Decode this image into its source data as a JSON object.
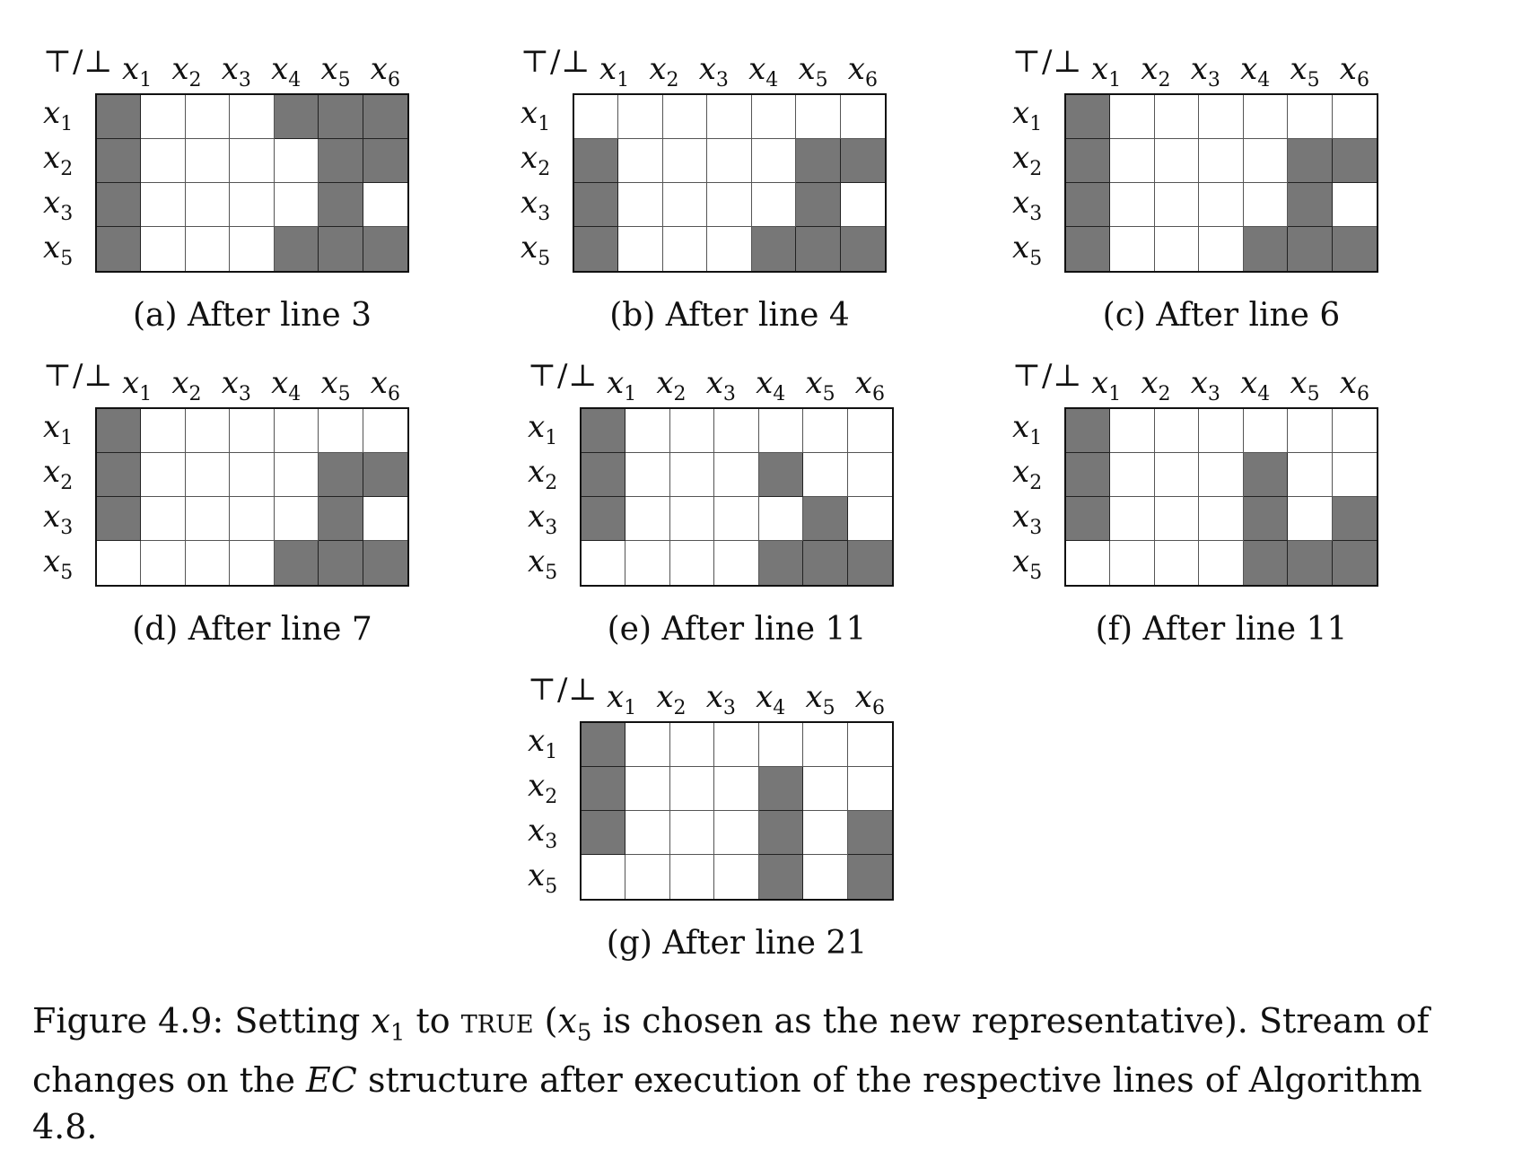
{
  "header": {
    "top_bottom": "⊤/⊥",
    "vars": [
      "x",
      "x",
      "x",
      "x",
      "x",
      "x"
    ],
    "var_subs": [
      "1",
      "2",
      "3",
      "4",
      "5",
      "6"
    ]
  },
  "rows": {
    "labels": [
      "x",
      "x",
      "x",
      "x"
    ],
    "subs": [
      "1",
      "2",
      "3",
      "5"
    ]
  },
  "panels": [
    {
      "caption": "(a) After line 3",
      "grid": [
        [
          1,
          0,
          0,
          0,
          1,
          1,
          1
        ],
        [
          1,
          0,
          0,
          0,
          0,
          1,
          1
        ],
        [
          1,
          0,
          0,
          0,
          0,
          1,
          0
        ],
        [
          1,
          0,
          0,
          0,
          1,
          1,
          1
        ]
      ]
    },
    {
      "caption": "(b) After line 4",
      "grid": [
        [
          0,
          0,
          0,
          0,
          0,
          0,
          0
        ],
        [
          1,
          0,
          0,
          0,
          0,
          1,
          1
        ],
        [
          1,
          0,
          0,
          0,
          0,
          1,
          0
        ],
        [
          1,
          0,
          0,
          0,
          1,
          1,
          1
        ]
      ]
    },
    {
      "caption": "(c) After line 6",
      "grid": [
        [
          1,
          0,
          0,
          0,
          0,
          0,
          0
        ],
        [
          1,
          0,
          0,
          0,
          0,
          1,
          1
        ],
        [
          1,
          0,
          0,
          0,
          0,
          1,
          0
        ],
        [
          1,
          0,
          0,
          0,
          1,
          1,
          1
        ]
      ]
    },
    {
      "caption": "(d) After line 7",
      "grid": [
        [
          1,
          0,
          0,
          0,
          0,
          0,
          0
        ],
        [
          1,
          0,
          0,
          0,
          0,
          1,
          1
        ],
        [
          1,
          0,
          0,
          0,
          0,
          1,
          0
        ],
        [
          0,
          0,
          0,
          0,
          1,
          1,
          1
        ]
      ]
    },
    {
      "caption": "(e) After line 11",
      "grid": [
        [
          1,
          0,
          0,
          0,
          0,
          0,
          0
        ],
        [
          1,
          0,
          0,
          0,
          1,
          0,
          0
        ],
        [
          1,
          0,
          0,
          0,
          0,
          1,
          0
        ],
        [
          0,
          0,
          0,
          0,
          1,
          1,
          1
        ]
      ]
    },
    {
      "caption": "(f) After line 11",
      "grid": [
        [
          1,
          0,
          0,
          0,
          0,
          0,
          0
        ],
        [
          1,
          0,
          0,
          0,
          1,
          0,
          0
        ],
        [
          1,
          0,
          0,
          0,
          1,
          0,
          1
        ],
        [
          0,
          0,
          0,
          0,
          1,
          1,
          1
        ]
      ]
    },
    {
      "caption": "(g) After line 21",
      "grid": [
        [
          1,
          0,
          0,
          0,
          0,
          0,
          0
        ],
        [
          1,
          0,
          0,
          0,
          1,
          0,
          0
        ],
        [
          1,
          0,
          0,
          0,
          1,
          0,
          1
        ],
        [
          0,
          0,
          0,
          0,
          1,
          0,
          1
        ]
      ]
    }
  ],
  "figure_caption": {
    "part1": "Figure 4.9: Setting ",
    "x1_var": "x",
    "x1_sub": "1",
    "part2": " to ",
    "true_word": "true",
    "part3": " (",
    "x5_var": "x",
    "x5_sub": "5",
    "part4": " is chosen as the new representative). Stream of changes on the ",
    "ec": "EC",
    "part5": " structure after execution of the respective lines of Algorithm 4.8."
  }
}
